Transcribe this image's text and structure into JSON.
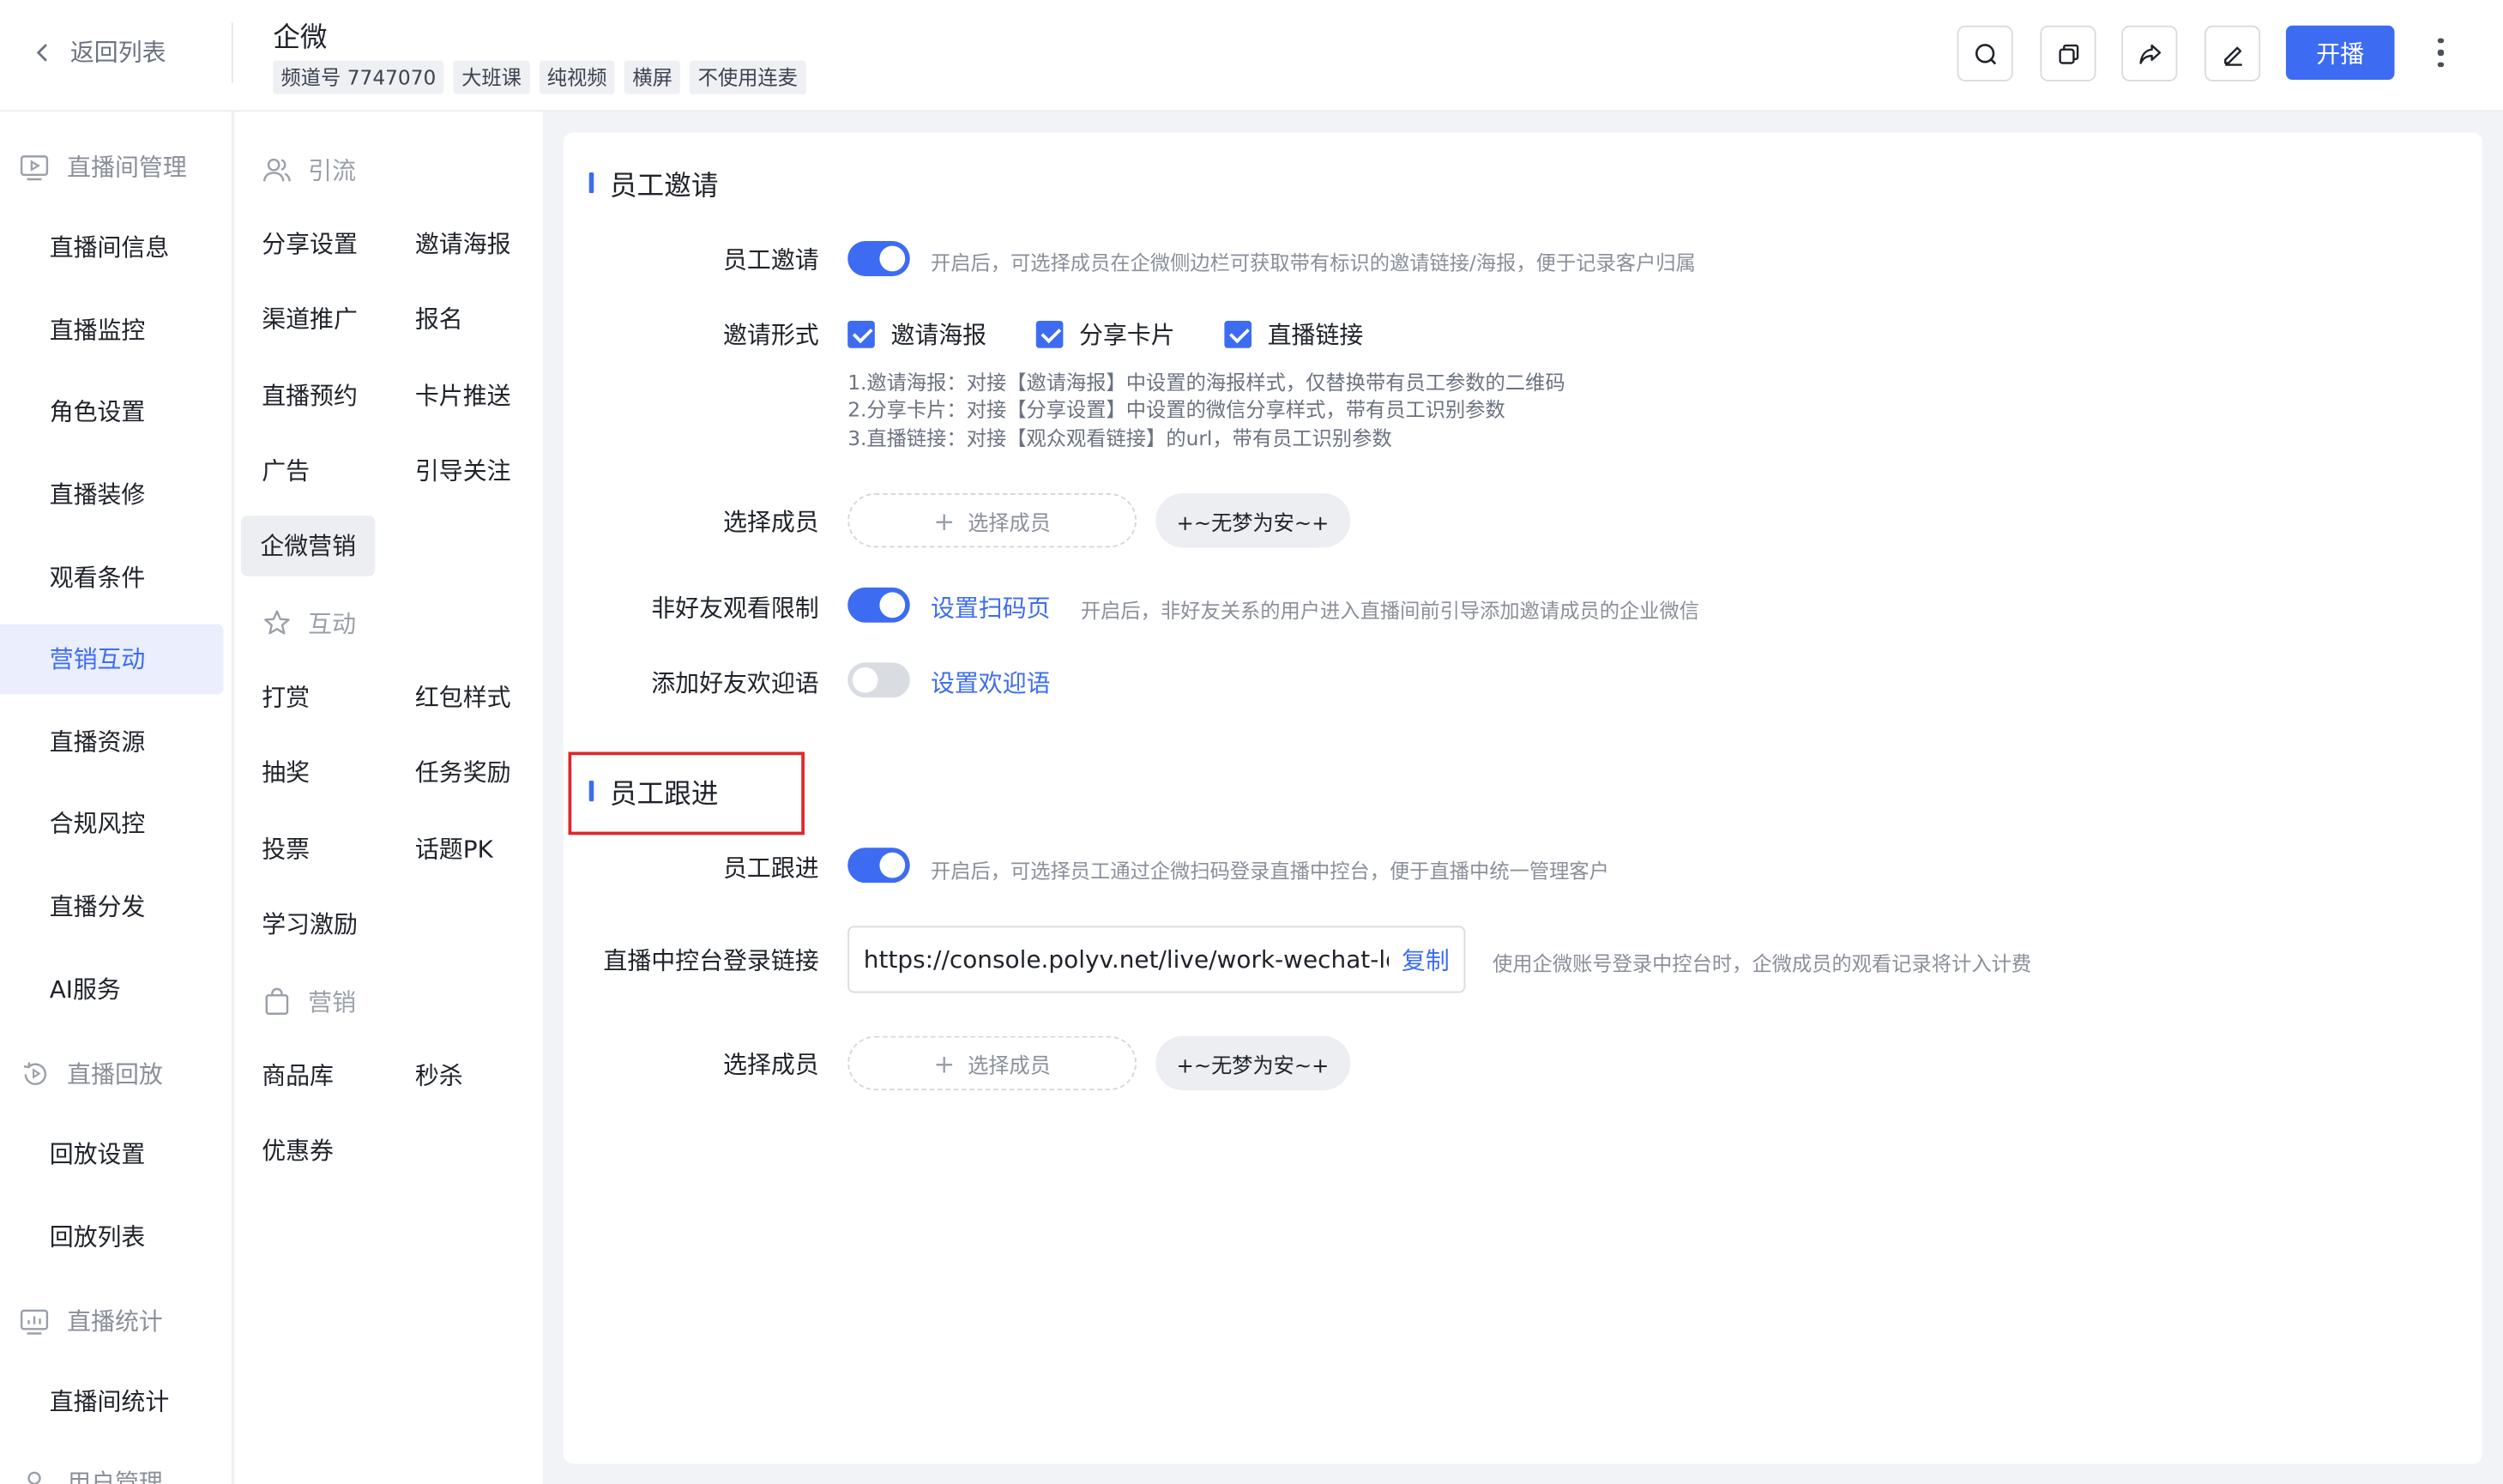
{
  "header": {
    "back_label": "返回列表",
    "title": "企微",
    "tags": [
      "频道号 7747070",
      "大班课",
      "纯视频",
      "横屏",
      "不使用连麦"
    ],
    "start_label": "开播",
    "icons": [
      "search-icon",
      "copy-icon",
      "share-icon",
      "edit-icon",
      "more-icon"
    ]
  },
  "nav": {
    "groups": [
      {
        "label": "直播间管理",
        "icon": "live-room-icon",
        "items": [
          "直播间信息",
          "直播监控",
          "角色设置",
          "直播装修",
          "观看条件",
          "营销互动",
          "直播资源",
          "合规风控",
          "直播分发",
          "AI服务"
        ]
      },
      {
        "label": "直播回放",
        "icon": "replay-icon",
        "items": [
          "回放设置",
          "回放列表"
        ]
      },
      {
        "label": "直播统计",
        "icon": "stats-icon",
        "items": [
          "直播间统计"
        ]
      },
      {
        "label": "用户管理",
        "icon": "user-icon",
        "items": []
      }
    ],
    "active_item": "营销互动"
  },
  "subnav": {
    "groups": [
      {
        "label": "引流",
        "icon": "users-icon",
        "items": [
          "分享设置",
          "邀请海报",
          "渠道推广",
          "报名",
          "直播预约",
          "卡片推送",
          "广告",
          "引导关注",
          "企微营销"
        ]
      },
      {
        "label": "互动",
        "icon": "star-icon",
        "items": [
          "打赏",
          "红包样式",
          "抽奖",
          "任务奖励",
          "投票",
          "话题PK",
          "学习激励"
        ]
      },
      {
        "label": "营销",
        "icon": "bag-icon",
        "items": [
          "商品库",
          "秒杀",
          "优惠券"
        ]
      }
    ],
    "active_item": "企微营销"
  },
  "main": {
    "invite": {
      "title": "员工邀请",
      "toggle_label": "员工邀请",
      "toggle_on": true,
      "toggle_hint": "开启后，可选择成员在企微侧边栏可获取带有标识的邀请链接/海报，便于记录客户归属",
      "form_label": "邀请形式",
      "options": [
        {
          "label": "邀请海报",
          "checked": true
        },
        {
          "label": "分享卡片",
          "checked": true
        },
        {
          "label": "直播链接",
          "checked": true
        }
      ],
      "notes": [
        "1.邀请海报：对接【邀请海报】中设置的海报样式，仅替换带有员工参数的二维码",
        "2.分享卡片：对接【分享设置】中设置的微信分享样式，带有员工识别参数",
        "3.直播链接：对接【观众观看链接】的url，带有员工识别参数"
      ],
      "member_label": "选择成员",
      "member_button": "选择成员",
      "member_chip": "+~无梦为安~+",
      "nonfriend_label": "非好友观看限制",
      "nonfriend_on": true,
      "nonfriend_link": "设置扫码页",
      "nonfriend_hint": "开启后，非好友关系的用户进入直播间前引导添加邀请成员的企业微信",
      "welcome_label": "添加好友欢迎语",
      "welcome_on": false,
      "welcome_link": "设置欢迎语"
    },
    "follow": {
      "title": "员工跟进",
      "toggle_label": "员工跟进",
      "toggle_on": true,
      "toggle_hint": "开启后，可选择员工通过企微扫码登录直播中控台，便于直播中统一管理客户",
      "url_label": "直播中控台登录链接",
      "url_value": "https://console.polyv.net/live/work-wechat-login.html",
      "copy_label": "复制",
      "url_hint": "使用企微账号登录中控台时，企微成员的观看记录将计入计费",
      "member_label": "选择成员",
      "member_button": "选择成员",
      "member_chip": "+~无梦为安~+"
    }
  }
}
